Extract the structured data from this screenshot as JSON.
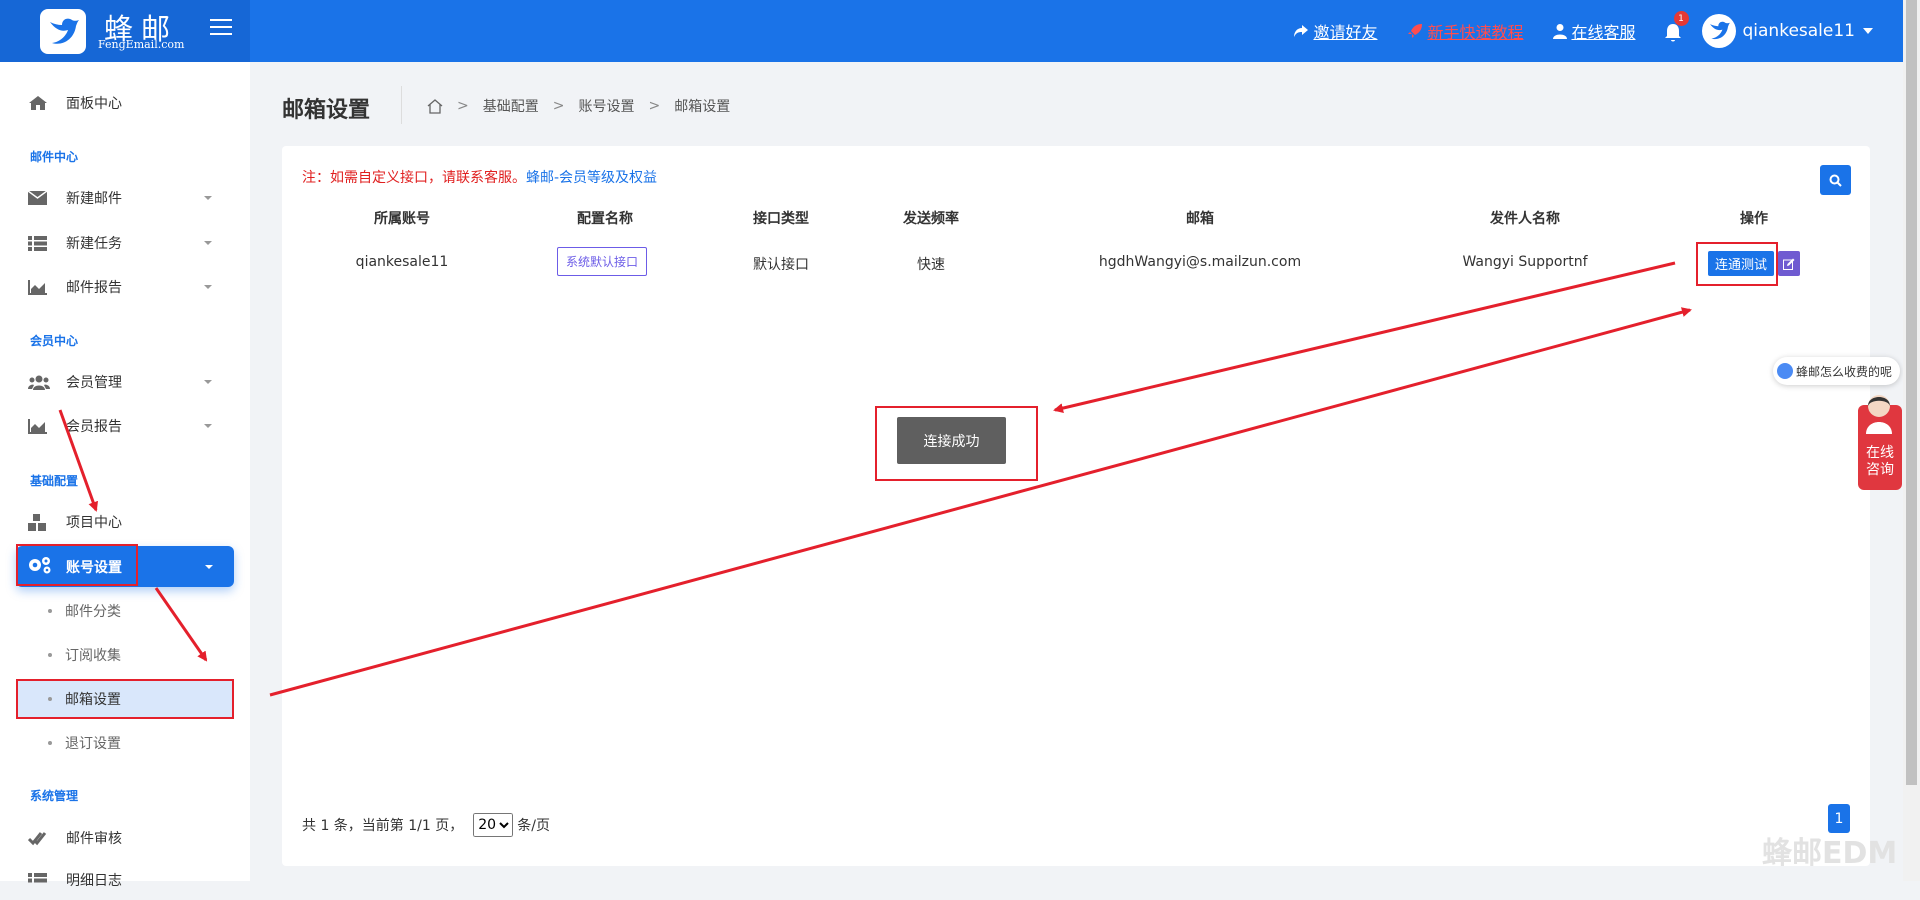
{
  "brand": {
    "name": "蜂邮",
    "sub": "FengEmail.com"
  },
  "topnav": {
    "invite": "邀请好友",
    "tutorial": "新手快速教程",
    "support": "在线客服",
    "notif_count": "1",
    "username": "qiankesale11"
  },
  "sidebar": {
    "dashboard": "面板中心",
    "group_mail": "邮件中心",
    "new_mail": "新建邮件",
    "new_task": "新建任务",
    "mail_report": "邮件报告",
    "group_member": "会员中心",
    "member_mgmt": "会员管理",
    "member_report": "会员报告",
    "group_basic": "基础配置",
    "project_center": "项目中心",
    "account_settings": "账号设置",
    "sub_items": [
      "邮件分类",
      "订阅收集",
      "邮箱设置",
      "退订设置"
    ],
    "group_system": "系统管理",
    "mail_review": "邮件审核",
    "mail_log": "明细日志"
  },
  "page": {
    "title": "邮箱设置",
    "breadcrumb": [
      "基础配置",
      "账号设置",
      "邮箱设置"
    ]
  },
  "notice": {
    "text": "注：如需自定义接口，请联系客服。",
    "link": "蜂邮-会员等级及权益"
  },
  "table": {
    "headers": [
      "所属账号",
      "配置名称",
      "接口类型",
      "发送频率",
      "邮箱",
      "发件人名称",
      "操作"
    ],
    "row": {
      "account": "qiankesale11",
      "config": "系统默认接口",
      "type": "默认接口",
      "freq": "快速",
      "email": "hgdhWangyi@s.mailzun.com",
      "sender": "Wangyi Supportnf",
      "test_btn": "连通测试"
    }
  },
  "toast": "连接成功",
  "pager": {
    "summary": "共 1 条，当前第 1/1 页，",
    "page_size": "20",
    "unit": "条/页",
    "current": "1"
  },
  "widgets": {
    "chat_bubble": "蜂邮怎么收费的呢",
    "online_line1": "在线",
    "online_line2": "咨询"
  },
  "watermark": "蜂邮EDM",
  "colors": {
    "primary": "#1a73e8",
    "annotation": "#e4202c",
    "config_tag": "#6c5ce7"
  }
}
